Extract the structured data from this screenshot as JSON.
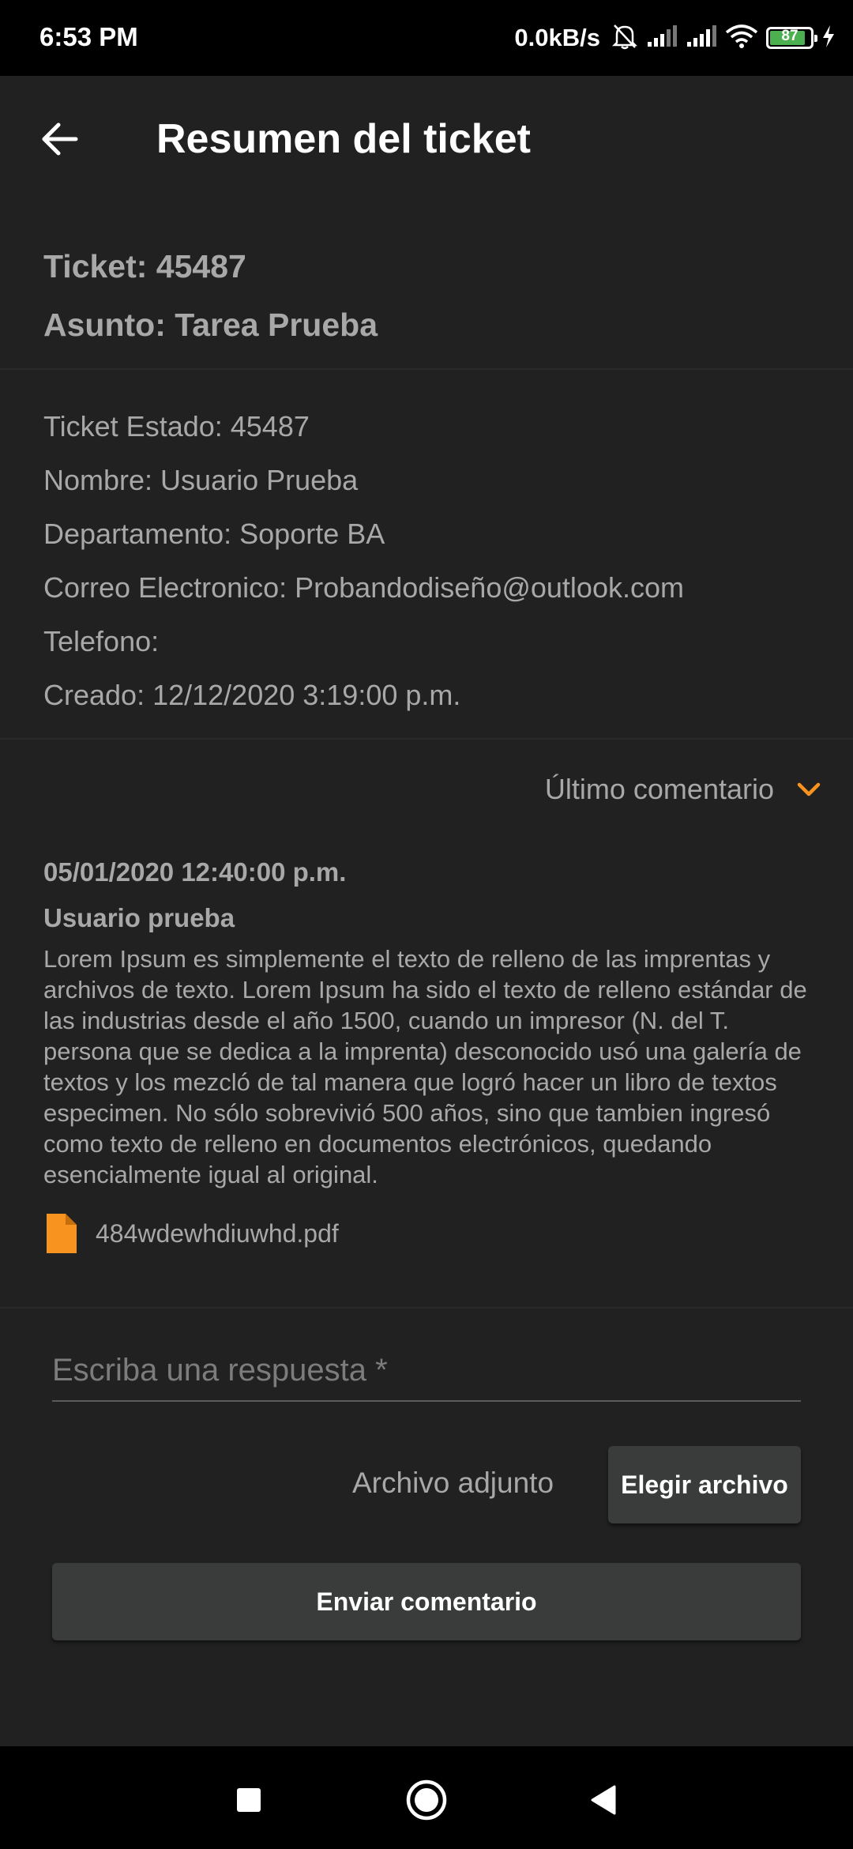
{
  "status_bar": {
    "time": "6:53 PM",
    "net_speed": "0.0kB/s",
    "battery_level": "87",
    "battery_fraction": 0.87,
    "icons": [
      "bell-off-icon",
      "signal-icon",
      "signal-icon",
      "wifi-icon",
      "battery-icon",
      "charging-icon"
    ]
  },
  "app_bar": {
    "title": "Resumen del ticket",
    "back_icon": "arrow-left-icon"
  },
  "ticket": {
    "number_line": "Ticket: 45487",
    "subject_line": "Asunto: Tarea Prueba"
  },
  "details": {
    "estado": "Ticket Estado: 45487",
    "nombre": "Nombre: Usuario Prueba",
    "departamento": "Departamento: Soporte BA",
    "correo": "Correo Electronico: Probandodiseño@outlook.com",
    "telefono": "Telefono:",
    "creado": "Creado: 12/12/2020 3:19:00 p.m."
  },
  "last_comment": {
    "toggle_label": "Último comentario",
    "toggle_icon": "chevron-down-icon",
    "accent_color": "#f7931e",
    "date": "05/01/2020 12:40:00 p.m.",
    "user": "Usuario prueba",
    "body": "Lorem Ipsum es simplemente el texto de relleno de las imprentas y archivos de texto. Lorem Ipsum ha sido el texto de relleno estándar de las industrias desde el año 1500, cuando un impresor (N. del T. persona que se dedica a la imprenta) desconocido usó una galería de textos y los mezcló de tal manera que logró hacer un libro de textos especimen. No sólo sobrevivió 500 años, sino que tambien ingresó como texto de relleno en documentos electrónicos, quedando esencialmente igual al original.",
    "attachment_name": "484wdewhdiuwhd.pdf",
    "attachment_icon": "file-icon"
  },
  "reply": {
    "placeholder": "Escriba una respuesta *",
    "value": "",
    "attach_label": "Archivo adjunto",
    "choose_file_label": "Elegir archivo",
    "send_label": "Enviar comentario"
  },
  "nav_bar": {
    "icons": [
      "recents-square-icon",
      "home-circle-icon",
      "back-triangle-icon"
    ]
  }
}
